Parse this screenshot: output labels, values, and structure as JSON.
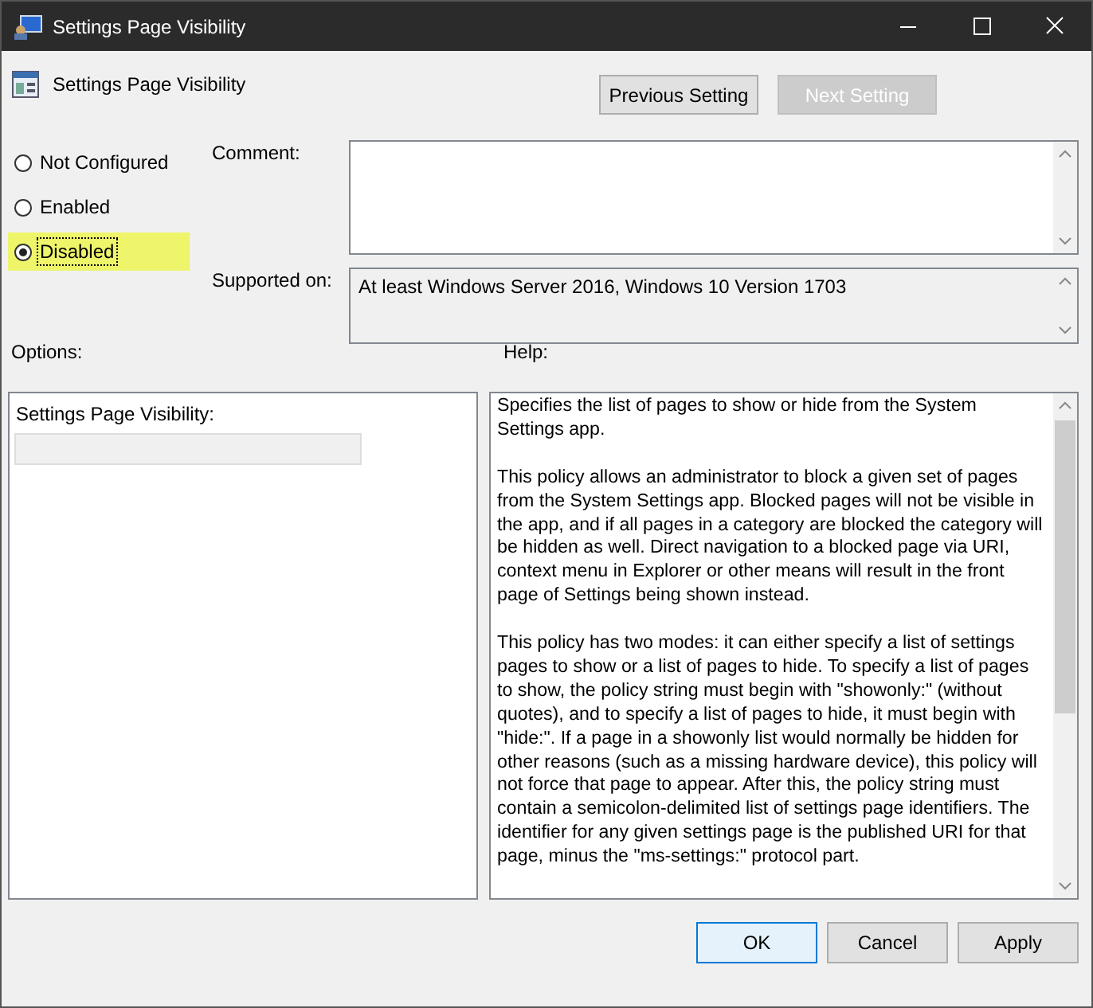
{
  "window": {
    "title": "Settings Page Visibility"
  },
  "header": {
    "title": "Settings Page Visibility"
  },
  "nav_buttons": [
    {
      "label": "Previous Setting",
      "disabled": false
    },
    {
      "label": "Next Setting",
      "disabled": true
    }
  ],
  "state_options": [
    {
      "label": "Not Configured",
      "selected": false
    },
    {
      "label": "Enabled",
      "selected": false
    },
    {
      "label": "Disabled",
      "selected": true
    }
  ],
  "comment": {
    "label": "Comment:"
  },
  "supported_on": {
    "label": "Supported on:",
    "value": "At least Windows Server 2016, Windows 10 Version 1703"
  },
  "options": {
    "label": "Options:",
    "field_label": "Settings Page Visibility:",
    "field_disabled": true
  },
  "help": {
    "label": "Help:",
    "paragraphs": [
      "Specifies the list of pages to show or hide from the System Settings app.",
      "This policy allows an administrator to block a given set of pages from the System Settings app. Blocked pages will not be visible in the app, and if all pages in a category are blocked the category will be hidden as well. Direct navigation to a blocked page via URI, context menu in Explorer or other means will result in the front page of Settings being shown instead.",
      "This policy has two modes: it can either specify a list of settings pages to show or a list of pages to hide. To specify a list of pages to show, the policy string must begin with \"showonly:\" (without quotes), and to specify a list of pages to hide, it must begin with \"hide:\". If a page in a showonly list would normally be hidden for other reasons (such as a missing hardware device), this policy will not force that page to appear. After this, the policy string must contain a semicolon-delimited list of settings page identifiers. The identifier for any given settings page is the published URI for that page, minus the \"ms-settings:\" protocol part."
    ]
  },
  "buttons": [
    {
      "label": "OK",
      "default": true
    },
    {
      "label": "Cancel",
      "default": false
    },
    {
      "label": "Apply",
      "default": false
    }
  ]
}
